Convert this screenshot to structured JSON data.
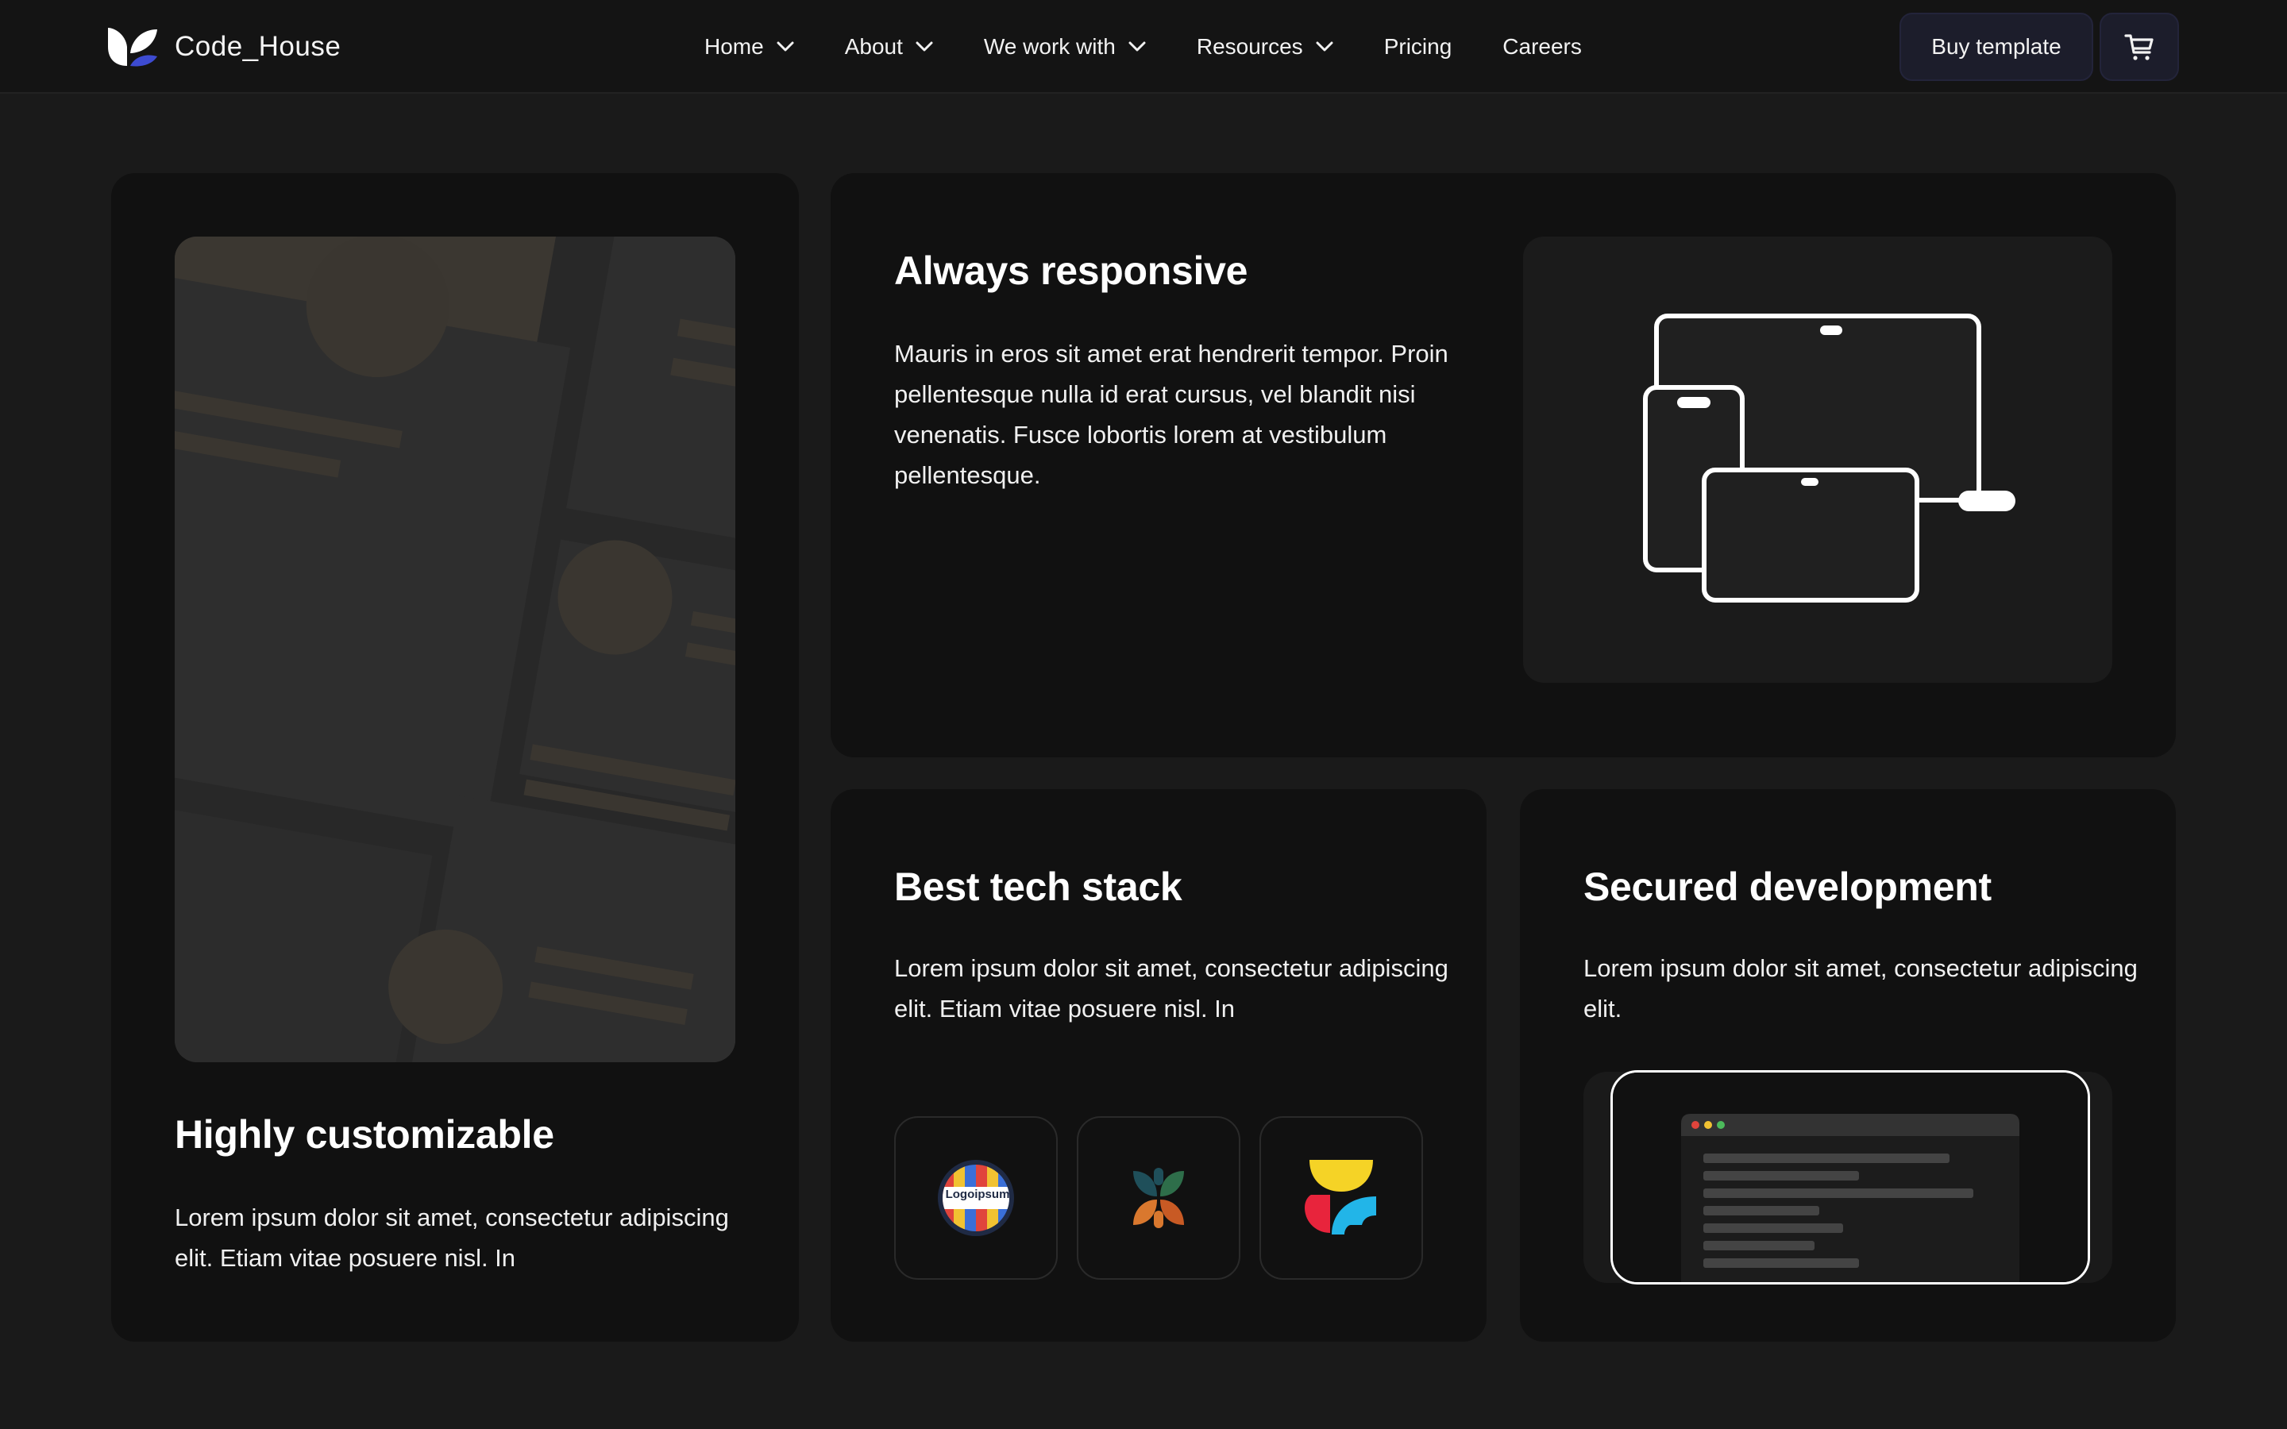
{
  "brand": {
    "name": "Code_House",
    "logo_icon": "leaf-logo-icon"
  },
  "nav": {
    "items": [
      {
        "label": "Home",
        "has_dropdown": true
      },
      {
        "label": "About",
        "has_dropdown": true
      },
      {
        "label": "We work with",
        "has_dropdown": true
      },
      {
        "label": "Resources",
        "has_dropdown": true
      },
      {
        "label": "Pricing",
        "has_dropdown": false
      },
      {
        "label": "Careers",
        "has_dropdown": false
      }
    ],
    "buy_label": "Buy template",
    "cart_icon": "cart-icon"
  },
  "features": {
    "customizable": {
      "title": "Highly customizable",
      "text": "Lorem ipsum dolor sit amet, consectetur adipiscing elit. Etiam vitae posuere nisl. In"
    },
    "responsive": {
      "title": "Always responsive",
      "text": "Mauris in eros sit amet erat hendrerit tempor. Proin pellentesque nulla id erat cursus, vel blandit nisi venenatis. Fusce lobortis lorem at vestibulum pellentesque."
    },
    "tech_stack": {
      "title": "Best tech stack",
      "text": "Lorem ipsum dolor sit amet, consectetur adipiscing elit. Etiam vitae posuere nisl. In",
      "logo_text": "Logoipsum"
    },
    "secured": {
      "title": "Secured development",
      "text": "Lorem ipsum dolor sit amet, consectetur adipiscing elit."
    }
  },
  "colors": {
    "page_bg": "#1a1a1a",
    "card_bg": "#111111",
    "accent": "#3d4bd1",
    "button_bg": "#1c1d2b"
  }
}
